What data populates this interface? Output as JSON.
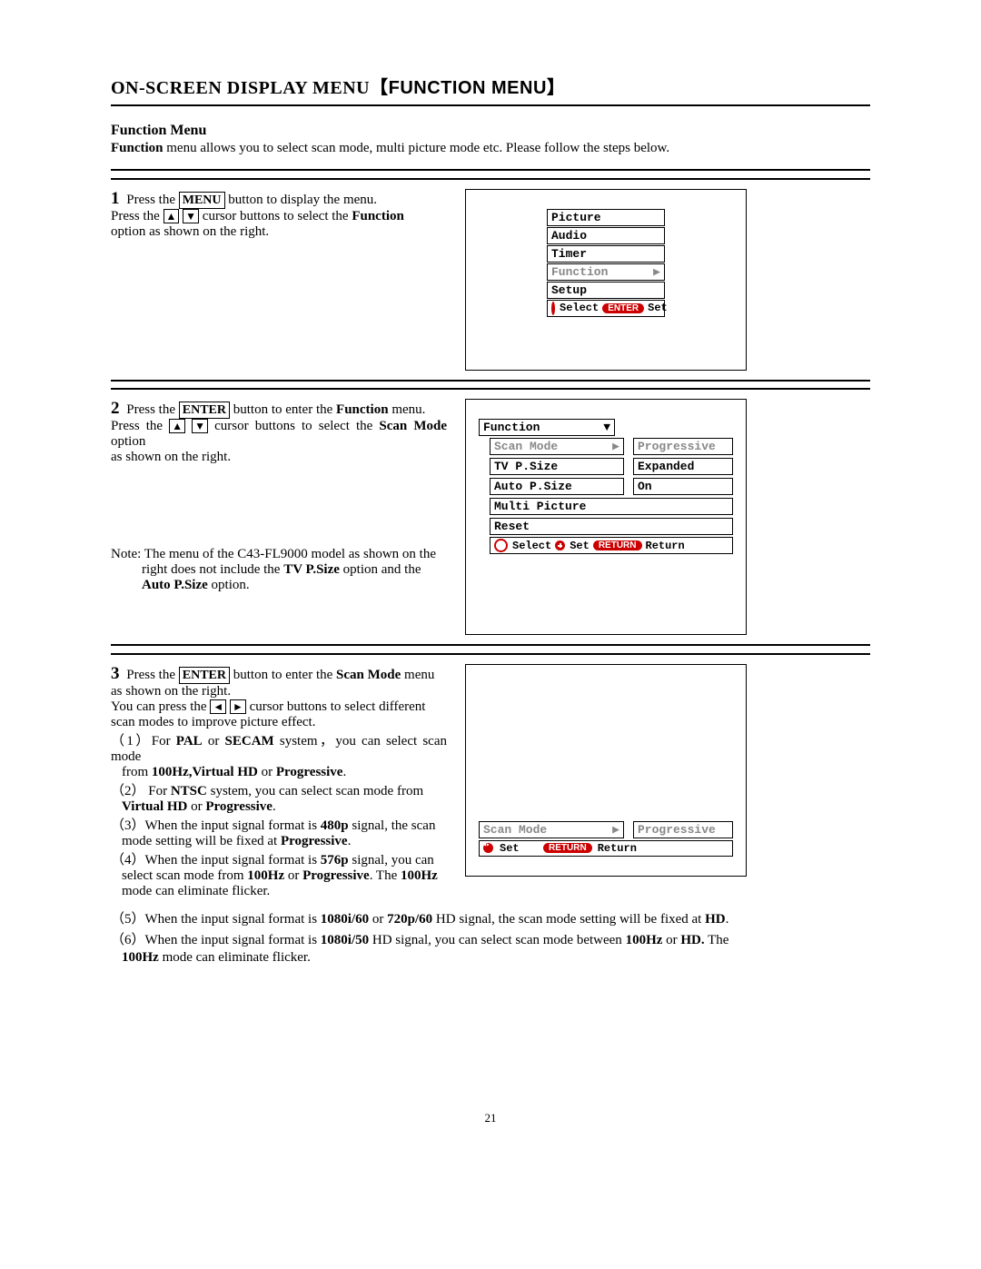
{
  "header": {
    "title_left": "ON-SCREEN DISPLAY MENU",
    "title_bracket": "【FUNCTION MENU】",
    "subtitle": "Function Menu",
    "intro_prefix_bold": "Function",
    "intro_rest": " menu allows you to select scan mode, multi picture mode etc. Please follow the steps below."
  },
  "step1": {
    "num": "1",
    "line1_a": " Press the ",
    "key_menu": "MENU",
    "line1_b": " button to display the menu.",
    "line2_a": "Press  the  ",
    "arrow_up": "▲",
    "arrow_down": "▼",
    "line2_b": "  cursor  buttons  to  select  the  ",
    "bold_function": "Function",
    "line3": "option as shown on the right.",
    "osd": {
      "items": [
        "Picture",
        "Audio",
        "Timer",
        "Function",
        "Setup"
      ],
      "selected_index": 3,
      "hint_select": "Select",
      "hint_enter_pill": "ENTER",
      "hint_set": "Set"
    }
  },
  "step2": {
    "num": "2",
    "line1_a": " Press the ",
    "key_enter": "ENTER",
    "line1_b": " button to enter the ",
    "bold_function": "Function",
    "line1_c": " menu.",
    "line2_a": "Press the ",
    "arrow_up": "▲",
    "arrow_down": "▼",
    "line2_b": " cursor buttons to select the ",
    "bold_scanmode": "Scan Mode",
    "line2_c": " option",
    "line3": "as shown on the right.",
    "note_a": "Note: The menu of the C43-FL9000 model as shown on the",
    "note_b_a": "right does not include the ",
    "note_b_bold1": "TV P.Size",
    "note_b_b": " option and the",
    "note_c_bold": "Auto P.Size",
    "note_c_rest": " option.",
    "osd": {
      "title": "Function",
      "rows": [
        {
          "label": "Scan Mode",
          "value": "Progressive",
          "selected": true
        },
        {
          "label": "TV P.Size",
          "value": "Expanded"
        },
        {
          "label": "Auto P.Size",
          "value": "On"
        },
        {
          "label": "Multi Picture"
        },
        {
          "label": "Reset"
        }
      ],
      "hint_select": "Select",
      "hint_set": "Set",
      "hint_return_pill": "RETURN",
      "hint_return": "Return"
    }
  },
  "step3": {
    "num": "3",
    "line1_a": " Press the ",
    "key_enter": "ENTER",
    "line1_b": " button to enter the ",
    "bold_scanmode": "Scan Mode",
    "line1_c": " menu",
    "line2": "as shown on the right.",
    "line3_a": "You can press the ",
    "arrow_left": "◄",
    "arrow_right": "►",
    "line3_b": " cursor buttons to select different",
    "line4": "scan modes to improve picture effect.",
    "pt1_a": "（1）For ",
    "pt1_bold1": "PAL",
    "pt1_mid": " or ",
    "pt1_bold2": "SECAM",
    "pt1_b": " system，you can select scan mode",
    "pt1_c_a": "from ",
    "pt1_c_bold": "100Hz,Virtual HD",
    "pt1_c_mid": " or ",
    "pt1_c_bold2": "Progressive",
    "pt1_c_end": ".",
    "pt2_a": "（2） For ",
    "pt2_bold": "NTSC",
    "pt2_b": " system, you can select scan mode from",
    "pt2_c_bold": "Virtual HD",
    "pt2_c_mid": " or ",
    "pt2_c_bold2": "Progressive",
    "pt2_c_end": ".",
    "pt3_a": "（3）When the input signal format is ",
    "pt3_bold": "480p",
    "pt3_b": " signal, the scan",
    "pt3_c_a": "mode setting will be fixed at ",
    "pt3_c_bold": "Progressive",
    "pt3_c_end": ".",
    "pt4_a": "（4）When the input signal format is ",
    "pt4_bold": "576p",
    "pt4_b": " signal, you can",
    "pt4_c_a": "select scan mode from ",
    "pt4_c_bold1": "100Hz",
    "pt4_c_mid": " or ",
    "pt4_c_bold2": "Progressive",
    "pt4_c_b": ". The ",
    "pt4_c_bold3": "100Hz",
    "pt4_d": "mode can eliminate flicker.",
    "osd": {
      "label": "Scan Mode",
      "value": "Progressive",
      "hint_set": "Set",
      "hint_return_pill": "RETURN",
      "hint_return": "Return"
    }
  },
  "after": {
    "pt5_a": "（5）When the input signal format is ",
    "pt5_bold1": "1080i/60",
    "pt5_mid1": " or ",
    "pt5_bold2": "720p/60",
    "pt5_b": " HD signal, the scan mode setting will be fixed at ",
    "pt5_bold3": "HD",
    "pt5_end": ".",
    "pt6_a": "（6）When the input signal format is ",
    "pt6_bold1": "1080i/50",
    "pt6_b": " HD signal, you can select scan mode between ",
    "pt6_bold2": "100Hz",
    "pt6_mid": " or ",
    "pt6_bold3": "HD.",
    "pt6_c": " The",
    "pt6_d_bold": "100Hz",
    "pt6_d_rest": " mode can eliminate flicker."
  },
  "page_number": "21"
}
